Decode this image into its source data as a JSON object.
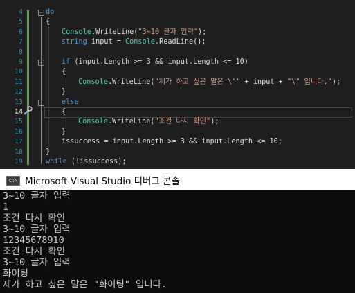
{
  "editor": {
    "lines": [
      {
        "num": "4",
        "segments": [
          {
            "t": "do",
            "c": "kw"
          }
        ]
      },
      {
        "num": "5",
        "segments": [
          {
            "t": "{",
            "c": ""
          }
        ]
      },
      {
        "num": "6",
        "segments": [
          {
            "t": "Console",
            "c": "typ"
          },
          {
            "t": ".WriteLine(",
            "c": ""
          },
          {
            "t": "\"3~10 글자 입력\"",
            "c": "str"
          },
          {
            "t": ");",
            "c": ""
          }
        ]
      },
      {
        "num": "7",
        "segments": [
          {
            "t": "string",
            "c": "kw"
          },
          {
            "t": " input = ",
            "c": ""
          },
          {
            "t": "Console",
            "c": "typ"
          },
          {
            "t": ".ReadLine();",
            "c": ""
          }
        ]
      },
      {
        "num": "8",
        "segments": []
      },
      {
        "num": "9",
        "segments": [
          {
            "t": "if",
            "c": "kw"
          },
          {
            "t": " (input.Length >= 3 && input.Length <= 10)",
            "c": ""
          }
        ]
      },
      {
        "num": "10",
        "segments": [
          {
            "t": "{",
            "c": ""
          }
        ]
      },
      {
        "num": "11",
        "segments": [
          {
            "t": "Console",
            "c": "typ"
          },
          {
            "t": ".WriteLine(",
            "c": ""
          },
          {
            "t": "\"제가 하고 싶은 말은 \\\"\"",
            "c": "str"
          },
          {
            "t": " + input + ",
            "c": ""
          },
          {
            "t": "\"\\\" 입니다.\"",
            "c": "str"
          },
          {
            "t": ");",
            "c": ""
          }
        ]
      },
      {
        "num": "12",
        "segments": [
          {
            "t": "}",
            "c": ""
          }
        ]
      },
      {
        "num": "13",
        "segments": [
          {
            "t": "else",
            "c": "kw"
          }
        ]
      },
      {
        "num": "14",
        "segments": [
          {
            "t": "{",
            "c": ""
          }
        ]
      },
      {
        "num": "15",
        "segments": [
          {
            "t": "Console",
            "c": "typ"
          },
          {
            "t": ".WriteLine(",
            "c": ""
          },
          {
            "t": "\"조건 다시 확인\"",
            "c": "str"
          },
          {
            "t": ");",
            "c": ""
          }
        ]
      },
      {
        "num": "16",
        "segments": [
          {
            "t": "}",
            "c": ""
          }
        ]
      },
      {
        "num": "17",
        "segments": [
          {
            "t": "issuccess = input.Length >= 3 && input.Length <= 10;",
            "c": ""
          }
        ]
      },
      {
        "num": "18",
        "segments": [
          {
            "t": "}",
            "c": ""
          }
        ]
      },
      {
        "num": "19",
        "segments": [
          {
            "t": "while",
            "c": "kw"
          },
          {
            "t": " (!issuccess);",
            "c": ""
          }
        ]
      }
    ]
  },
  "console_window": {
    "icon_text": "C:\\",
    "title": "Microsoft Visual Studio 디버그 콘솔",
    "output": [
      "3~10 글자 입력",
      "1",
      "조건 다시 확인",
      "3~10 글자 입력",
      "12345678910",
      "조건 다시 확인",
      "3~10 글자 입력",
      "화이팅",
      "제가 하고 싶은 말은 \"화이팅\" 입니다."
    ]
  },
  "colors": {
    "editor_bg": "#1e1e1e",
    "keyword": "#569cd6",
    "string": "#d69d85",
    "type": "#4ec9b0",
    "line_number": "#2b91af",
    "console_bg": "#0c0c0c",
    "console_text": "#cccccc"
  }
}
